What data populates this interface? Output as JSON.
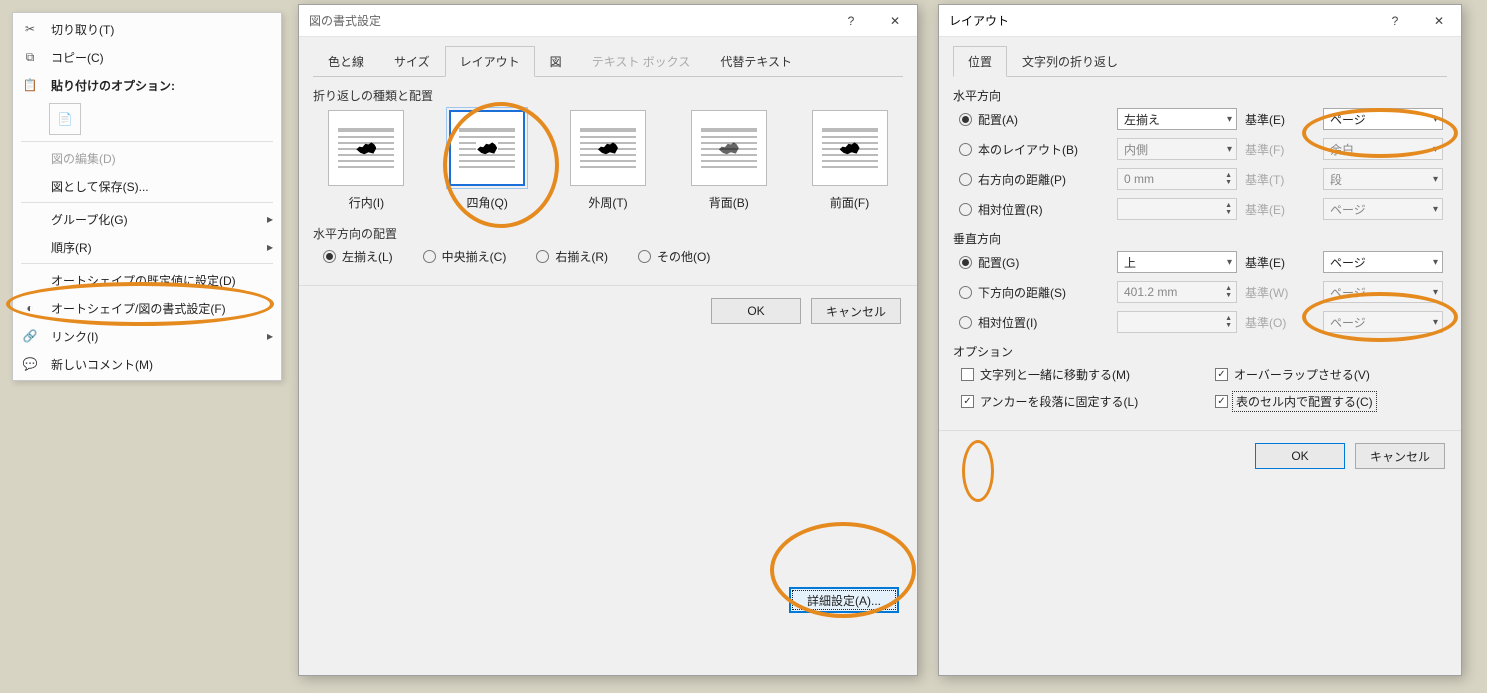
{
  "context_menu": {
    "cut": "切り取り(T)",
    "copy": "コピー(C)",
    "paste_heading": "貼り付けのオプション:",
    "edit_picture": "図の編集(D)",
    "save_as_picture": "図として保存(S)...",
    "group": "グループ化(G)",
    "order": "順序(R)",
    "set_autoshape_default": "オートシェイプの既定値に設定(D)",
    "format_autoshape": "オートシェイプ/図の書式設定(F)",
    "link": "リンク(I)",
    "new_comment": "新しいコメント(M)"
  },
  "format_dialog": {
    "title": "図の書式設定",
    "tabs": {
      "colors_lines": "色と線",
      "size": "サイズ",
      "layout": "レイアウト",
      "picture": "図",
      "textbox": "テキスト ボックス",
      "alt_text": "代替テキスト"
    },
    "wrap_group": "折り返しの種類と配置",
    "wrap": {
      "inline": "行内(I)",
      "square": "四角(Q)",
      "tight": "外周(T)",
      "behind": "背面(B)",
      "front": "前面(F)"
    },
    "halign_group": "水平方向の配置",
    "halign": {
      "left": "左揃え(L)",
      "center": "中央揃え(C)",
      "right": "右揃え(R)",
      "other": "その他(O)"
    },
    "advanced": "詳細設定(A)...",
    "ok": "OK",
    "cancel": "キャンセル"
  },
  "layout_dialog": {
    "title": "レイアウト",
    "tabs": {
      "position": "位置",
      "wrap": "文字列の折り返し"
    },
    "horiz_section": "水平方向",
    "horiz": {
      "alignment": "配置(A)",
      "book_layout": "本のレイアウト(B)",
      "abs_right": "右方向の距離(P)",
      "rel_pos": "相対位置(R)",
      "alignment_value": "左揃え",
      "book_value": "内側",
      "abs_value": "0 mm",
      "ref_alignment": "基準(E)",
      "ref_book": "基準(F)",
      "ref_abs": "基準(T)",
      "ref_rel": "基準(E)",
      "ref_alignment_value": "ページ",
      "ref_book_value": "余白",
      "ref_abs_value": "段",
      "ref_rel_value": "ページ"
    },
    "vert_section": "垂直方向",
    "vert": {
      "alignment": "配置(G)",
      "abs_down": "下方向の距離(S)",
      "rel_pos": "相対位置(I)",
      "alignment_value": "上",
      "abs_value": "401.2 mm",
      "ref_alignment": "基準(E)",
      "ref_abs": "基準(W)",
      "ref_rel": "基準(O)",
      "ref_alignment_value": "ページ",
      "ref_abs_value": "ページ",
      "ref_rel_value": "ページ"
    },
    "options_section": "オプション",
    "options": {
      "move_with_text": "文字列と一緒に移動する(M)",
      "lock_anchor": "アンカーを段落に固定する(L)",
      "allow_overlap": "オーバーラップさせる(V)",
      "layout_in_cell": "表のセル内で配置する(C)"
    },
    "ok": "OK",
    "cancel": "キャンセル"
  }
}
